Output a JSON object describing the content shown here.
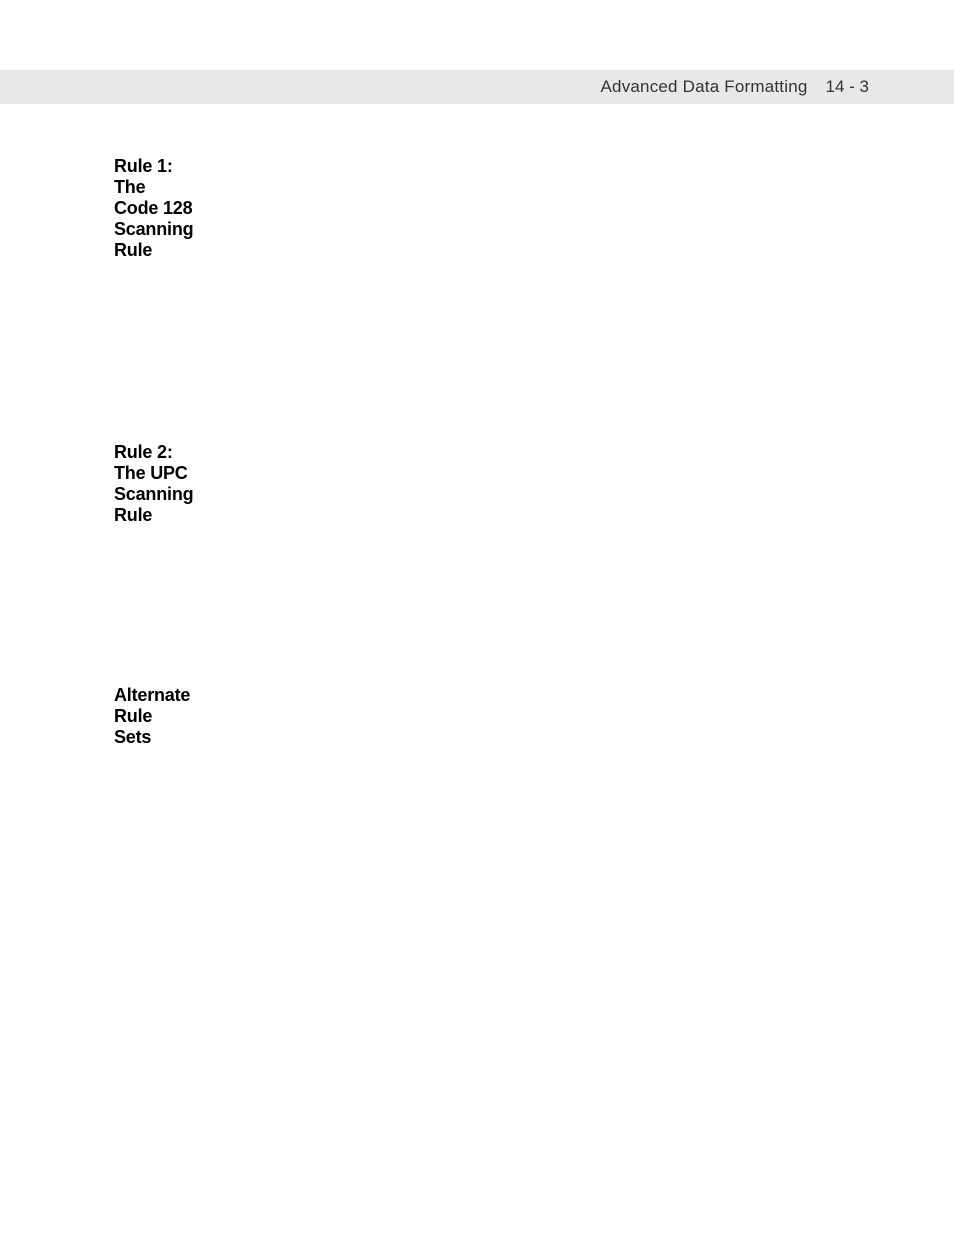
{
  "header": {
    "title": "Advanced Data Formatting",
    "page": "14 - 3"
  },
  "sections": {
    "rule1": "Rule 1: The Code 128 Scanning Rule",
    "rule2": "Rule 2: The UPC Scanning Rule",
    "alternate": "Alternate Rule Sets"
  }
}
